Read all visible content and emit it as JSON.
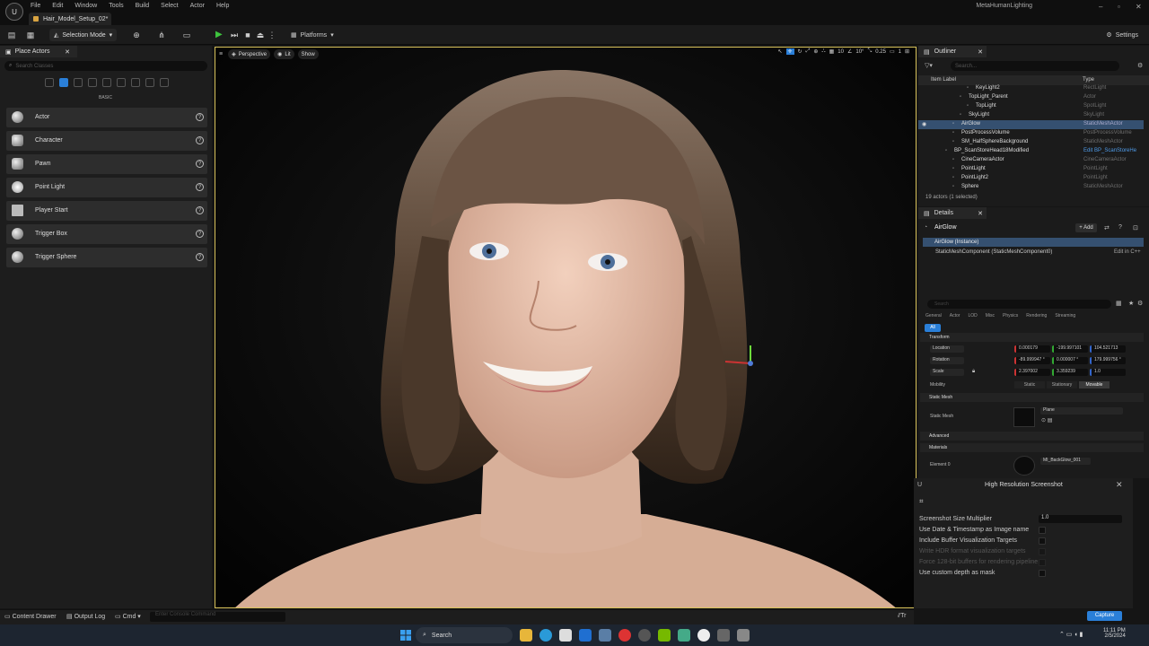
{
  "menu": [
    "File",
    "Edit",
    "Window",
    "Tools",
    "Build",
    "Select",
    "Actor",
    "Help"
  ],
  "document_tab": "Hair_Model_Setup_02*",
  "project_name": "MetaHumanLighting",
  "toolbar": {
    "selection_mode": "Selection Mode",
    "platforms": "Platforms",
    "settings": "Settings"
  },
  "place_actors": {
    "tab_label": "Place Actors",
    "search_placeholder": "Search Classes",
    "category_label": "BASIC",
    "items": [
      {
        "label": "Actor",
        "icon": "sphere-icon"
      },
      {
        "label": "Character",
        "icon": "pawn-icon"
      },
      {
        "label": "Pawn",
        "icon": "pawn-icon"
      },
      {
        "label": "Point Light",
        "icon": "bulb-icon"
      },
      {
        "label": "Player Start",
        "icon": "flag-icon"
      },
      {
        "label": "Trigger Box",
        "icon": "sphere-icon"
      },
      {
        "label": "Trigger Sphere",
        "icon": "sphere-icon"
      }
    ]
  },
  "viewport": {
    "perspective": "Perspective",
    "lit": "Lit",
    "show": "Show",
    "grid_snap": "10",
    "rot_snap": "10°",
    "scale_snap": "0.25",
    "camera_speed": "1"
  },
  "outliner": {
    "tab_label": "Outliner",
    "search_placeholder": "Search...",
    "col_label": "Item Label",
    "col_type": "Type",
    "rows": [
      {
        "label": "KeyLight2",
        "type": "RectLight",
        "indent": 3,
        "selected": false,
        "type_link": false
      },
      {
        "label": "TopLight_Parent",
        "type": "Actor",
        "indent": 2,
        "selected": false,
        "type_link": false
      },
      {
        "label": "TopLight",
        "type": "SpotLight",
        "indent": 3,
        "selected": false,
        "type_link": false
      },
      {
        "label": "SkyLight",
        "type": "SkyLight",
        "indent": 2,
        "selected": false,
        "type_link": false
      },
      {
        "label": "AirGlow",
        "type": "StaticMeshActor",
        "indent": 1,
        "selected": true,
        "type_link": false
      },
      {
        "label": "PostProcessVolume",
        "type": "PostProcessVolume",
        "indent": 1,
        "selected": false,
        "type_link": false
      },
      {
        "label": "SM_HalfSphereBackground",
        "type": "StaticMeshActor",
        "indent": 1,
        "selected": false,
        "type_link": false
      },
      {
        "label": "BP_ScanStoreHead18Modified",
        "type": "Edit BP_ScanStoreHe",
        "indent": 0,
        "selected": false,
        "type_link": true
      },
      {
        "label": "CineCameraActor",
        "type": "CineCameraActor",
        "indent": 1,
        "selected": false,
        "type_link": false
      },
      {
        "label": "PointLight",
        "type": "PointLight",
        "indent": 1,
        "selected": false,
        "type_link": false
      },
      {
        "label": "PointLight2",
        "type": "PointLight",
        "indent": 1,
        "selected": false,
        "type_link": false
      },
      {
        "label": "Sphere",
        "type": "StaticMeshActor",
        "indent": 1,
        "selected": false,
        "type_link": false
      }
    ],
    "count": "19 actors (1 selected)"
  },
  "details": {
    "tab_label": "Details",
    "actor_name": "AirGlow",
    "add_label": "+ Add",
    "instance_label": "AirGlow (Instance)",
    "component_label": "StaticMeshComponent (StaticMeshComponent0)",
    "edit_cpp": "Edit in C++",
    "search_placeholder": "Search",
    "filters": [
      "General",
      "Actor",
      "LOD",
      "Misc",
      "Physics",
      "Rendering",
      "Streaming"
    ],
    "all_label": "All",
    "transform_section": "Transform",
    "location_label": "Location",
    "location": [
      "0.000179",
      "-199.997101",
      "104.521713"
    ],
    "rotation_label": "Rotation",
    "rotation": [
      "-89.999947 °",
      "0.000007 °",
      "179.999756 °"
    ],
    "scale_label": "Scale",
    "scale": [
      "2.397002",
      "3.359239",
      "1.0"
    ],
    "mobility_label": "Mobility",
    "mobility": [
      "Static",
      "Stationary",
      "Movable"
    ],
    "static_mesh_section": "Static Mesh",
    "static_mesh_label": "Static Mesh",
    "static_mesh_value": "Plane",
    "advanced_section": "Advanced",
    "materials_section": "Materials",
    "element_label": "Element 0",
    "element_value": "MI_BackGlow_001"
  },
  "screenshot_dialog": {
    "title": "High Resolution Screenshot",
    "size_multiplier_label": "Screenshot Size Multiplier",
    "size_multiplier_value": "1.0",
    "options": [
      {
        "label": "Use Date & Timestamp as Image name",
        "enabled": true
      },
      {
        "label": "Include Buffer Visualization Targets",
        "enabled": true
      },
      {
        "label": "Write HDR format visualization targets",
        "enabled": false
      },
      {
        "label": "Force 128-bit buffers for rendering pipeline",
        "enabled": false
      },
      {
        "label": "Use custom depth as mask",
        "enabled": true
      }
    ],
    "capture_label": "Capture"
  },
  "bottom_bar": {
    "content_drawer": "Content Drawer",
    "output_log": "Output Log",
    "cmd": "Cmd",
    "console_placeholder": "Enter Console Command",
    "trace": "Tr"
  },
  "taskbar": {
    "search": "Search",
    "time": "11:11 PM",
    "date": "2/5/2024"
  },
  "colors": {
    "accent": "#2a7fd8",
    "viewport_border": "#d8c25a",
    "selection": "#355070"
  }
}
